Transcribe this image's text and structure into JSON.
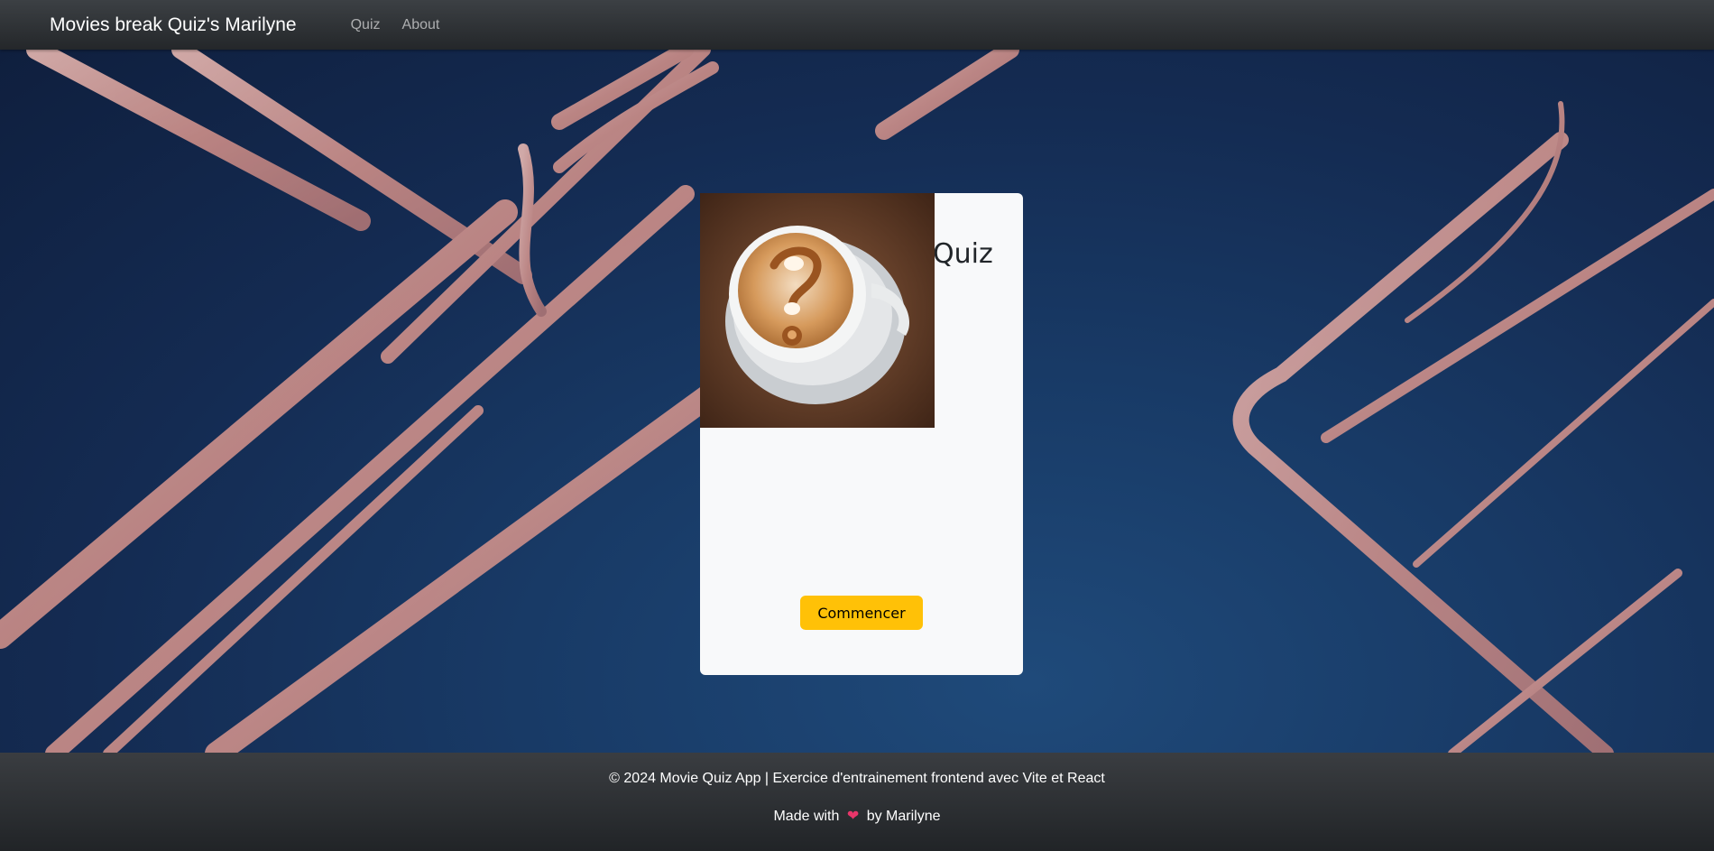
{
  "navbar": {
    "brand": "Movies break Quiz's Marilyne",
    "links": [
      "Quiz",
      "About"
    ]
  },
  "card": {
    "title": "Coffee break's Quiz",
    "image_icon": "coffee-question-latte-icon",
    "start_label": "Commencer"
  },
  "footer": {
    "copyright": "© 2024 Movie Quiz App | Exercice d'entrainement frontend avec Vite et React",
    "made_with": "Made with",
    "heart_icon": "❤",
    "by": "by Marilyne"
  },
  "colors": {
    "accent": "#ffc107",
    "navbar": "#343a40",
    "card": "#f8f9fa",
    "heart": "#e8366a"
  }
}
